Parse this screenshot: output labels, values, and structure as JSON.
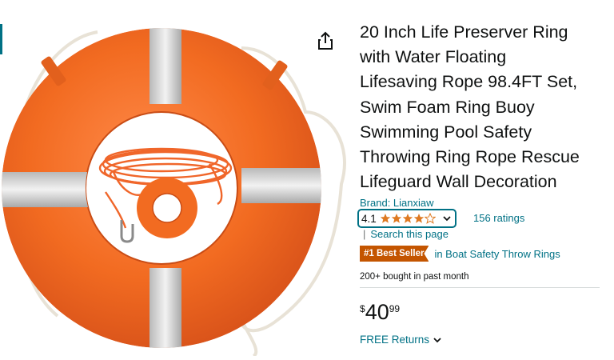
{
  "product": {
    "title_lines": [
      "20 Inch Life Preserver Ring",
      "with Water Floating",
      "Lifesaving Rope 98.4FT Set,",
      "Swim Foam Ring Buoy",
      "Swimming Pool Safety",
      "Throwing Ring Rope Rescue",
      "Lifeguard Wall Decoration"
    ],
    "brand_label": "Brand: Lianxiaw"
  },
  "rating": {
    "value": "4.1",
    "stars_filled": 4,
    "stars_total": 5,
    "count_label": "156 ratings",
    "search_label": "Search this page"
  },
  "bestseller": {
    "badge": "#1 Best Seller",
    "category": "in Boat Safety Throw Rings"
  },
  "bought_label": "200+ bought in past month",
  "price": {
    "symbol": "$",
    "whole": "40",
    "fraction": "99"
  },
  "returns_label": "FREE Returns",
  "icons": {
    "share": "share-icon",
    "rating_dropdown": "chevron-down-icon",
    "returns_dropdown": "chevron-down-icon"
  },
  "colors": {
    "link": "#007185",
    "badge_bg": "#c45500",
    "star": "#de7921",
    "buoy": "#f26b21"
  }
}
